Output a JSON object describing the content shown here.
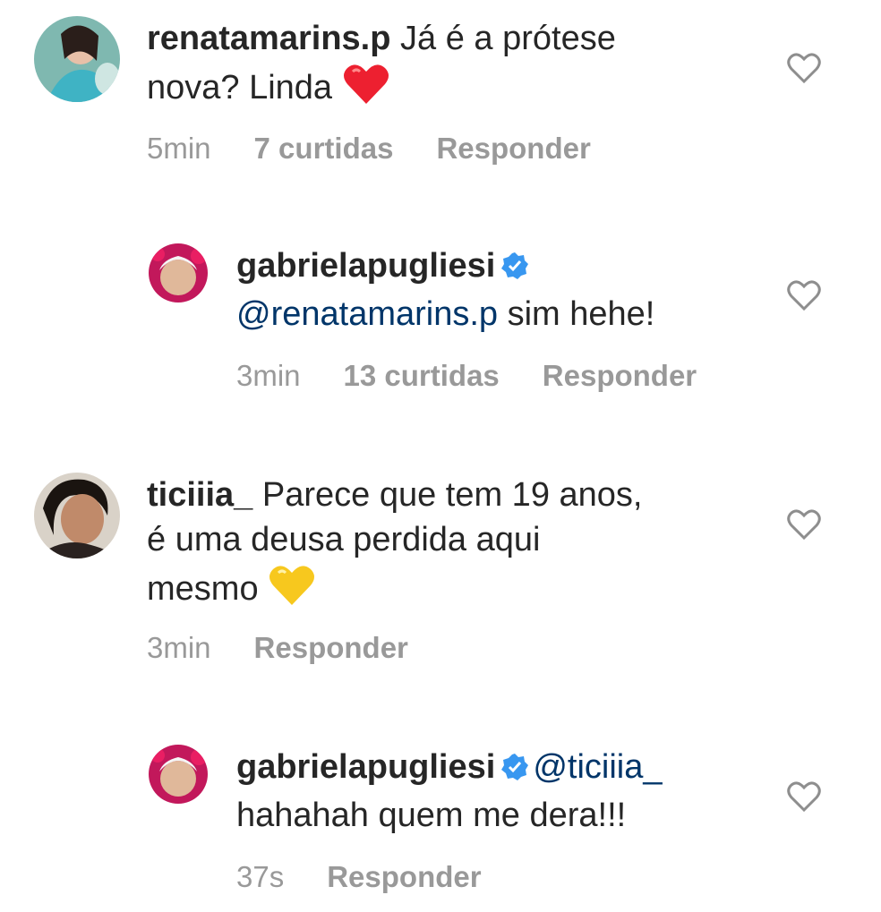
{
  "comments": [
    {
      "username": "renatamarins.p",
      "text_line1": "Já é a prótese",
      "text_line2": "nova? Linda",
      "emoji": "red-heart",
      "time": "5min",
      "likes": "7 curtidas",
      "reply": "Responder"
    },
    {
      "username": "gabrielapugliesi",
      "verified": true,
      "mention": "@renatamarins.p",
      "text": "sim hehe!",
      "time": "3min",
      "likes": "13 curtidas",
      "reply": "Responder"
    },
    {
      "username": "ticiiia_",
      "text_line1": "Parece que tem 19 anos,",
      "text_line2": "é uma deusa perdida aqui",
      "text_line3": "mesmo",
      "emoji": "yellow-heart",
      "time": "3min",
      "reply": "Responder"
    },
    {
      "username": "gabrielapugliesi",
      "verified": true,
      "mention": "@ticiiia_",
      "text": "hahahah quem me dera!!!",
      "time": "37s",
      "reply": "Responder"
    }
  ],
  "colors": {
    "text": "#262626",
    "meta": "#999999",
    "mention": "#003569",
    "verified": "#3897f0",
    "heart_red": "#ed4956",
    "heart_yellow": "#f5c518"
  }
}
